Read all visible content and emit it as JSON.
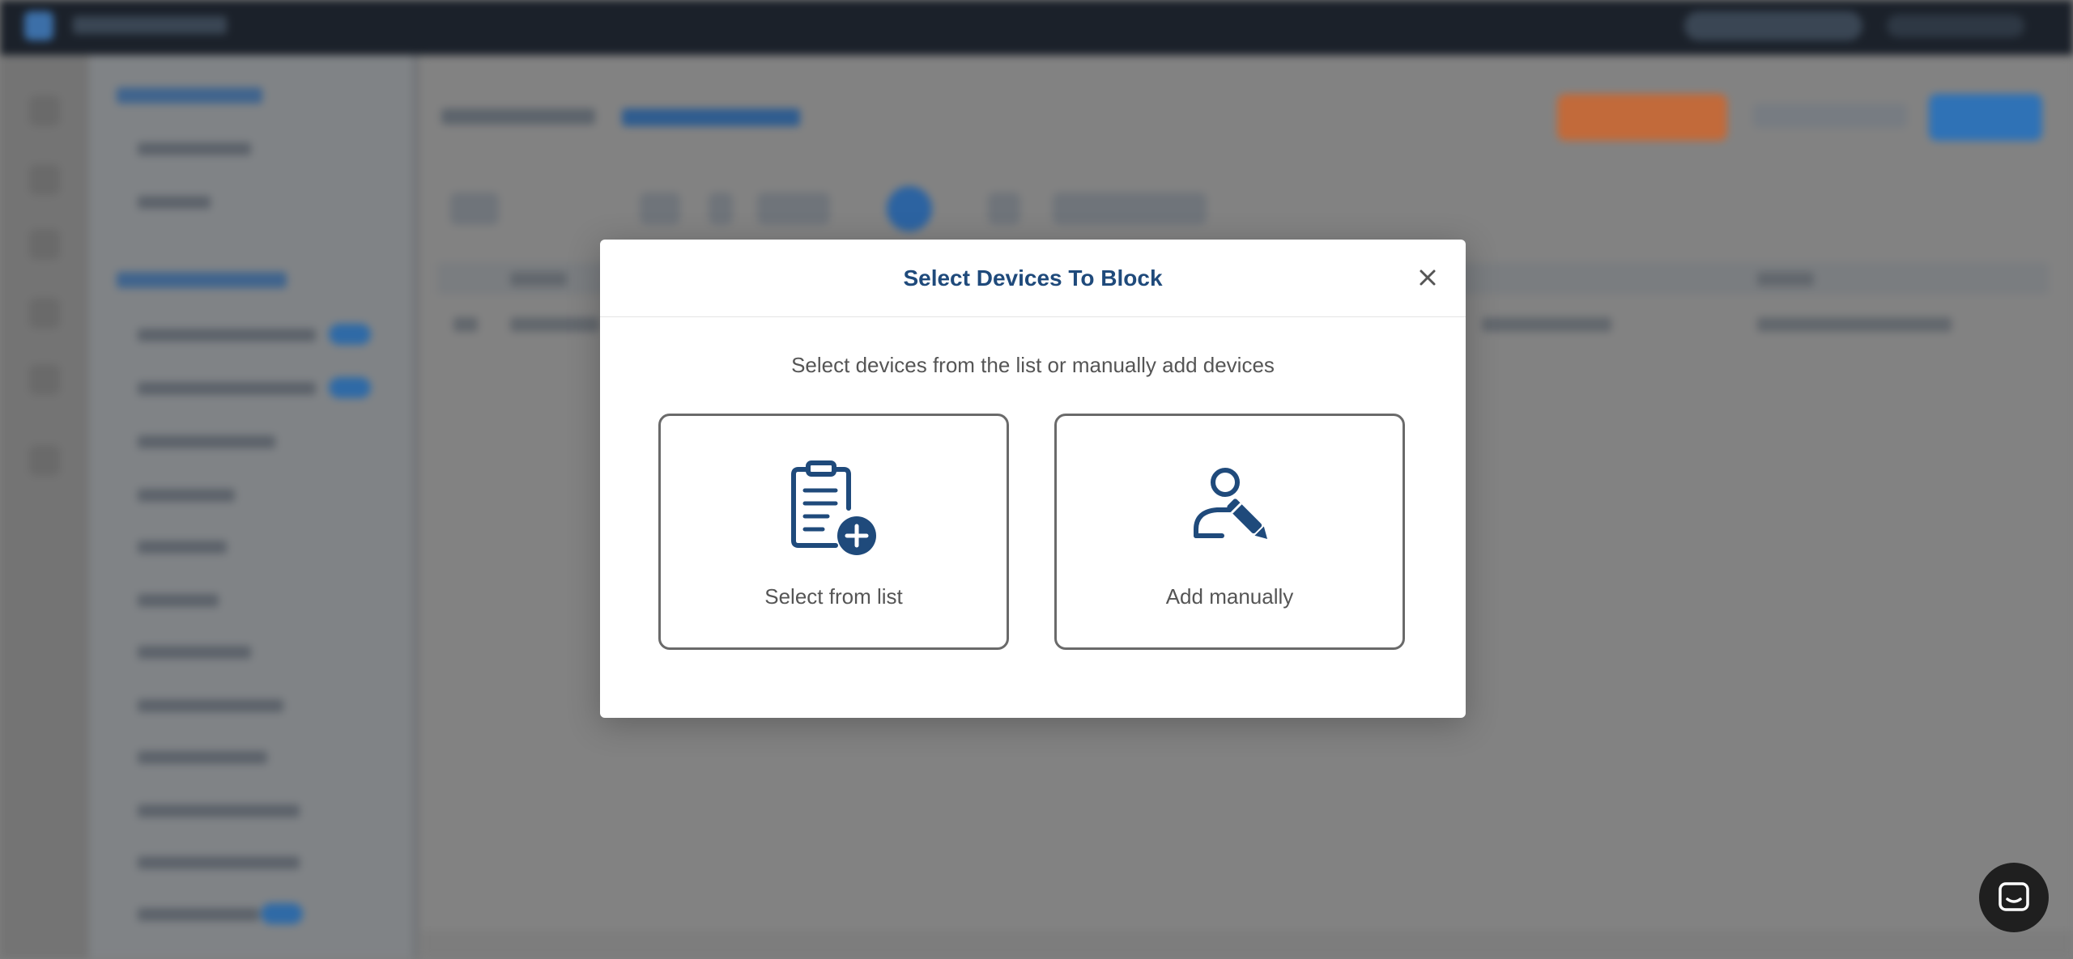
{
  "modal": {
    "title": "Select Devices To Block",
    "subtitle": "Select devices from the list or manually add devices",
    "options": [
      {
        "label": "Select from list",
        "icon": "clipboard-add-icon"
      },
      {
        "label": "Add manually",
        "icon": "user-edit-icon"
      }
    ],
    "close_icon": "close-icon"
  },
  "chat": {
    "icon": "chat-icon"
  },
  "colors": {
    "accent": "#1f4a7b",
    "overlay": "#7f7f7f",
    "option_border": "#6a6a6a"
  }
}
